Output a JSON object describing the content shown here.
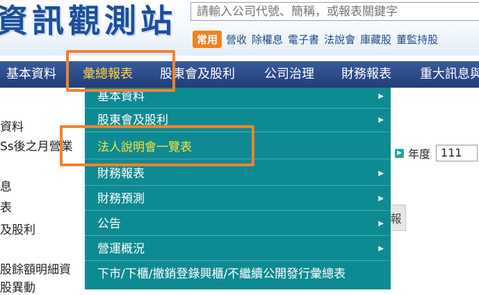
{
  "header": {
    "site_title": "資訊觀測站",
    "search_placeholder": "請輸入公司代號、簡稱，或報表關鍵字",
    "common_label": "常用",
    "quick_links": [
      "營收",
      "除權息",
      "電子書",
      "法說會",
      "庫藏股",
      "董監持股"
    ]
  },
  "nav": {
    "items": [
      "基本資料",
      "彙總報表",
      "股東會及股利",
      "公司治理",
      "財務報表",
      "重大訊息與"
    ],
    "active": "彙總報表"
  },
  "dropdown": {
    "items": [
      {
        "label": "基本資料",
        "has_submenu": true
      },
      {
        "label": "股東會及股利",
        "has_submenu": true
      },
      {
        "label": "法人說明會一覽表",
        "has_submenu": false,
        "highlighted": true
      },
      {
        "label": "財務報表",
        "has_submenu": true
      },
      {
        "label": "財務預測",
        "has_submenu": true
      },
      {
        "label": "公告",
        "has_submenu": true
      },
      {
        "label": "營運概況",
        "has_submenu": true
      },
      {
        "label": "下市/下櫃/撤銷登錄興櫃/不繼續公開發行彙總表",
        "has_submenu": false
      }
    ]
  },
  "background": {
    "left_lines": [
      "資料",
      "Ss後之月營業",
      "息",
      "表",
      "及股利",
      "股餘額明細資",
      "股異動"
    ],
    "year_label": "年度",
    "year_value": "111",
    "query_fragment": "報"
  },
  "colors": {
    "nav_bg": "#2b4a8a",
    "dropdown_bg": "#0e8a93",
    "highlight_border": "#f2832a",
    "active_text": "#ffd738"
  }
}
